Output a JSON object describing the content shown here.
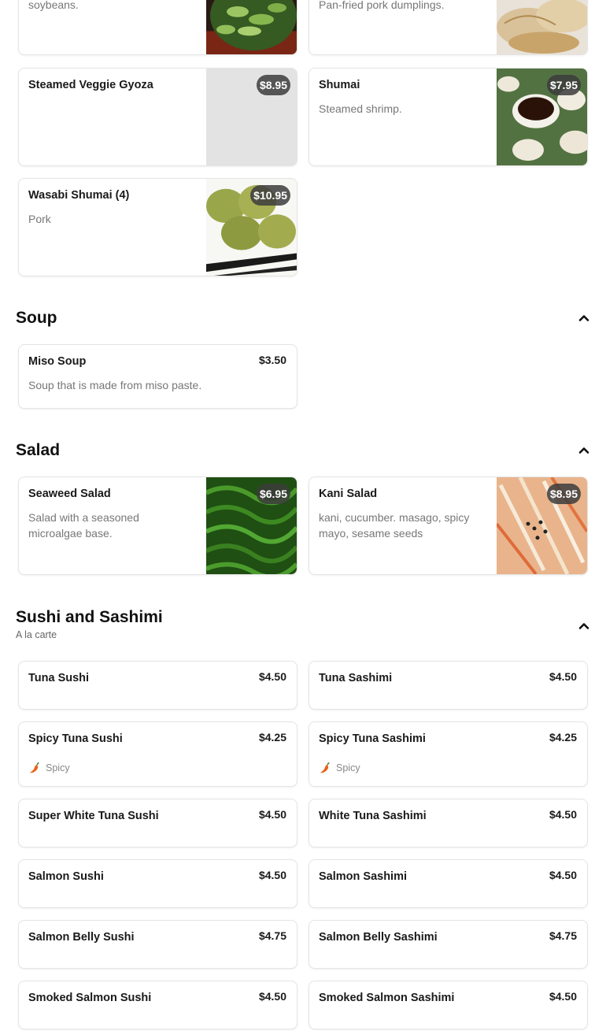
{
  "top_cards": [
    {
      "desc": "soybeans."
    },
    {
      "desc": "Pan-fried pork dumplings."
    }
  ],
  "appetizers": [
    {
      "name": "Steamed Veggie Gyoza",
      "price": "$8.95",
      "desc": ""
    },
    {
      "name": "Shumai",
      "price": "$7.95",
      "desc": "Steamed shrimp."
    },
    {
      "name": "Wasabi Shumai (4)",
      "price": "$10.95",
      "desc": "Pork"
    }
  ],
  "soup": {
    "title": "Soup",
    "items": [
      {
        "name": "Miso Soup",
        "price": "$3.50",
        "desc": "Soup that is made from miso paste."
      }
    ]
  },
  "salad": {
    "title": "Salad",
    "items": [
      {
        "name": "Seaweed Salad",
        "price": "$6.95",
        "desc": "Salad with a seasoned microalgae base."
      },
      {
        "name": "Kani Salad",
        "price": "$8.95",
        "desc": "kani, cucumber. masago, spicy mayo, sesame seeds"
      }
    ]
  },
  "sushi": {
    "title": "Sushi and Sashimi",
    "subtitle": "A la carte",
    "spicy_label": "Spicy",
    "items": [
      {
        "name": "Tuna Sushi",
        "price": "$4.50"
      },
      {
        "name": "Tuna Sashimi",
        "price": "$4.50"
      },
      {
        "name": "Spicy Tuna Sushi",
        "price": "$4.25"
      },
      {
        "name": "Spicy Tuna Sashimi",
        "price": "$4.25"
      },
      {
        "name": "Super White Tuna Sushi",
        "price": "$4.50"
      },
      {
        "name": "White Tuna Sashimi",
        "price": "$4.50"
      },
      {
        "name": "Salmon Sushi",
        "price": "$4.50"
      },
      {
        "name": "Salmon Sashimi",
        "price": "$4.50"
      },
      {
        "name": "Salmon Belly Sushi",
        "price": "$4.75"
      },
      {
        "name": "Salmon Belly Sashimi",
        "price": "$4.75"
      },
      {
        "name": "Smoked Salmon Sushi",
        "price": "$4.50"
      },
      {
        "name": "Smoked Salmon Sashimi",
        "price": "$4.50"
      }
    ]
  },
  "icons": {
    "collapse": "chevron-up-icon",
    "spicy": "chili-pepper-icon"
  },
  "colors": {
    "price_pill_bg": "#3c3c3c",
    "chili": "#e8641b"
  }
}
